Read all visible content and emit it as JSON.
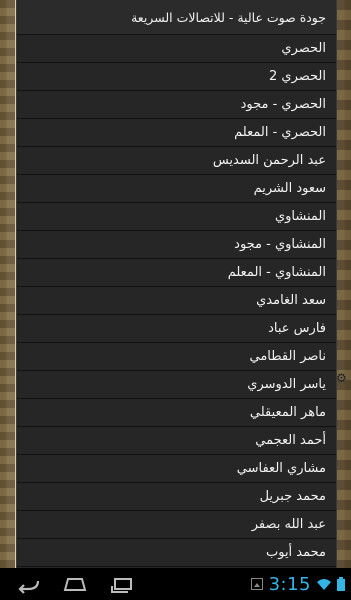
{
  "menu": {
    "items": [
      "جودة صوت عالية - للاتصالات السريعة",
      "الحصري",
      "الحصري 2",
      "الحصري - مجود",
      "الحصري - المعلم",
      "عبد الرحمن السديس",
      "سعود الشريم",
      "المنشاوي",
      "المنشاوي - مجود",
      "المنشاوي - المعلم",
      "سعد الغامدي",
      "فارس عباد",
      "ناصر القطامي",
      "ياسر الدوسري",
      "ماهر المعيقلي",
      "أحمد العجمي",
      "مشاري العفاسي",
      "محمد جبريل",
      "عبد الله بصفر",
      "محمد أيوب"
    ]
  },
  "status_bar": {
    "time": "3:15"
  },
  "colors": {
    "clock": "#33b5e5",
    "dialog_bg": "#262626"
  }
}
